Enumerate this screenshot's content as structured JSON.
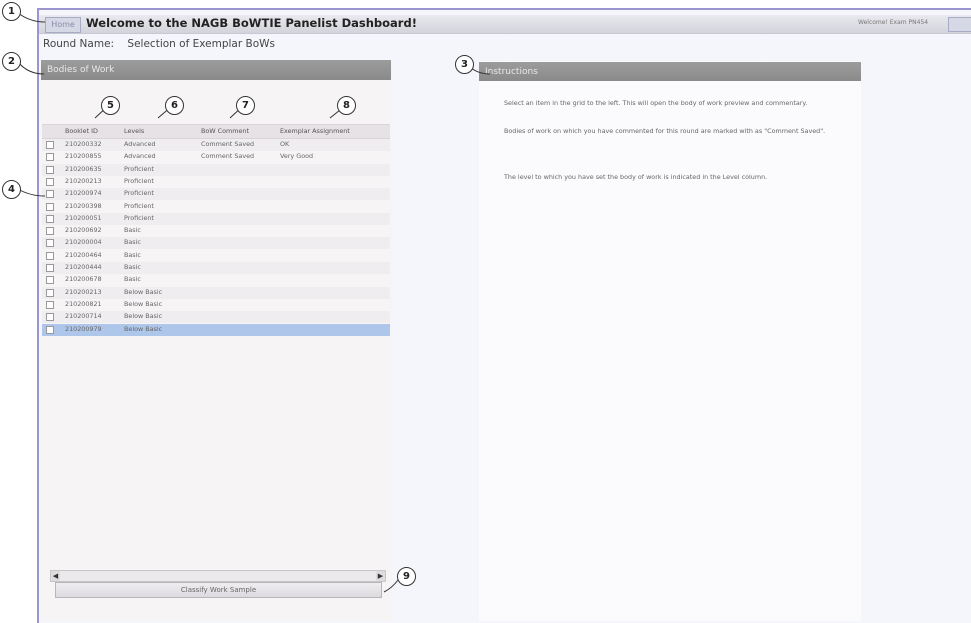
{
  "header": {
    "home_label": "Home",
    "title": "Welcome to the NAGB BoWTIE Panelist Dashboard!",
    "welcome_text": "Welcome! Exam PN454",
    "logout_label": ""
  },
  "round": {
    "label": "Round Name:",
    "value": "Selection of Exemplar BoWs"
  },
  "bodies_panel": {
    "title": "Bodies of Work",
    "columns": [
      "Booklet ID",
      "Levels",
      "BoW Comment",
      "Exemplar Assignment"
    ],
    "rows": [
      {
        "id": "210200332",
        "level": "Advanced",
        "comment": "Comment Saved",
        "assignment": "OK"
      },
      {
        "id": "210200855",
        "level": "Advanced",
        "comment": "Comment Saved",
        "assignment": "Very Good"
      },
      {
        "id": "210200635",
        "level": "Proficient",
        "comment": "",
        "assignment": ""
      },
      {
        "id": "210200213",
        "level": "Proficient",
        "comment": "",
        "assignment": ""
      },
      {
        "id": "210200974",
        "level": "Proficient",
        "comment": "",
        "assignment": ""
      },
      {
        "id": "210200398",
        "level": "Proficient",
        "comment": "",
        "assignment": ""
      },
      {
        "id": "210200051",
        "level": "Proficient",
        "comment": "",
        "assignment": ""
      },
      {
        "id": "210200692",
        "level": "Basic",
        "comment": "",
        "assignment": ""
      },
      {
        "id": "210200004",
        "level": "Basic",
        "comment": "",
        "assignment": ""
      },
      {
        "id": "210200464",
        "level": "Basic",
        "comment": "",
        "assignment": ""
      },
      {
        "id": "210200444",
        "level": "Basic",
        "comment": "",
        "assignment": ""
      },
      {
        "id": "210200678",
        "level": "Basic",
        "comment": "",
        "assignment": ""
      },
      {
        "id": "210200213",
        "level": "Below Basic",
        "comment": "",
        "assignment": ""
      },
      {
        "id": "210200821",
        "level": "Below Basic",
        "comment": "",
        "assignment": ""
      },
      {
        "id": "210200714",
        "level": "Below Basic",
        "comment": "",
        "assignment": ""
      },
      {
        "id": "210200979",
        "level": "Below Basic",
        "comment": "",
        "assignment": ""
      }
    ],
    "submit_label": "Classify Work Sample"
  },
  "instructions_panel": {
    "title": "Instructions",
    "paragraphs": [
      "Select an item in the grid to the left. This will open the body of work preview and commentary.",
      "Bodies of work on which you have commented for this round are marked with as \"Comment Saved\".",
      "The level to which you have set the body of work is indicated in the Level column."
    ]
  },
  "callouts": [
    "1",
    "2",
    "3",
    "4",
    "5",
    "6",
    "7",
    "8",
    "9"
  ],
  "colors": {
    "frame": "#9b96cf",
    "header_bar": "#8a8a8a",
    "selected_row": "#aec6ea"
  }
}
